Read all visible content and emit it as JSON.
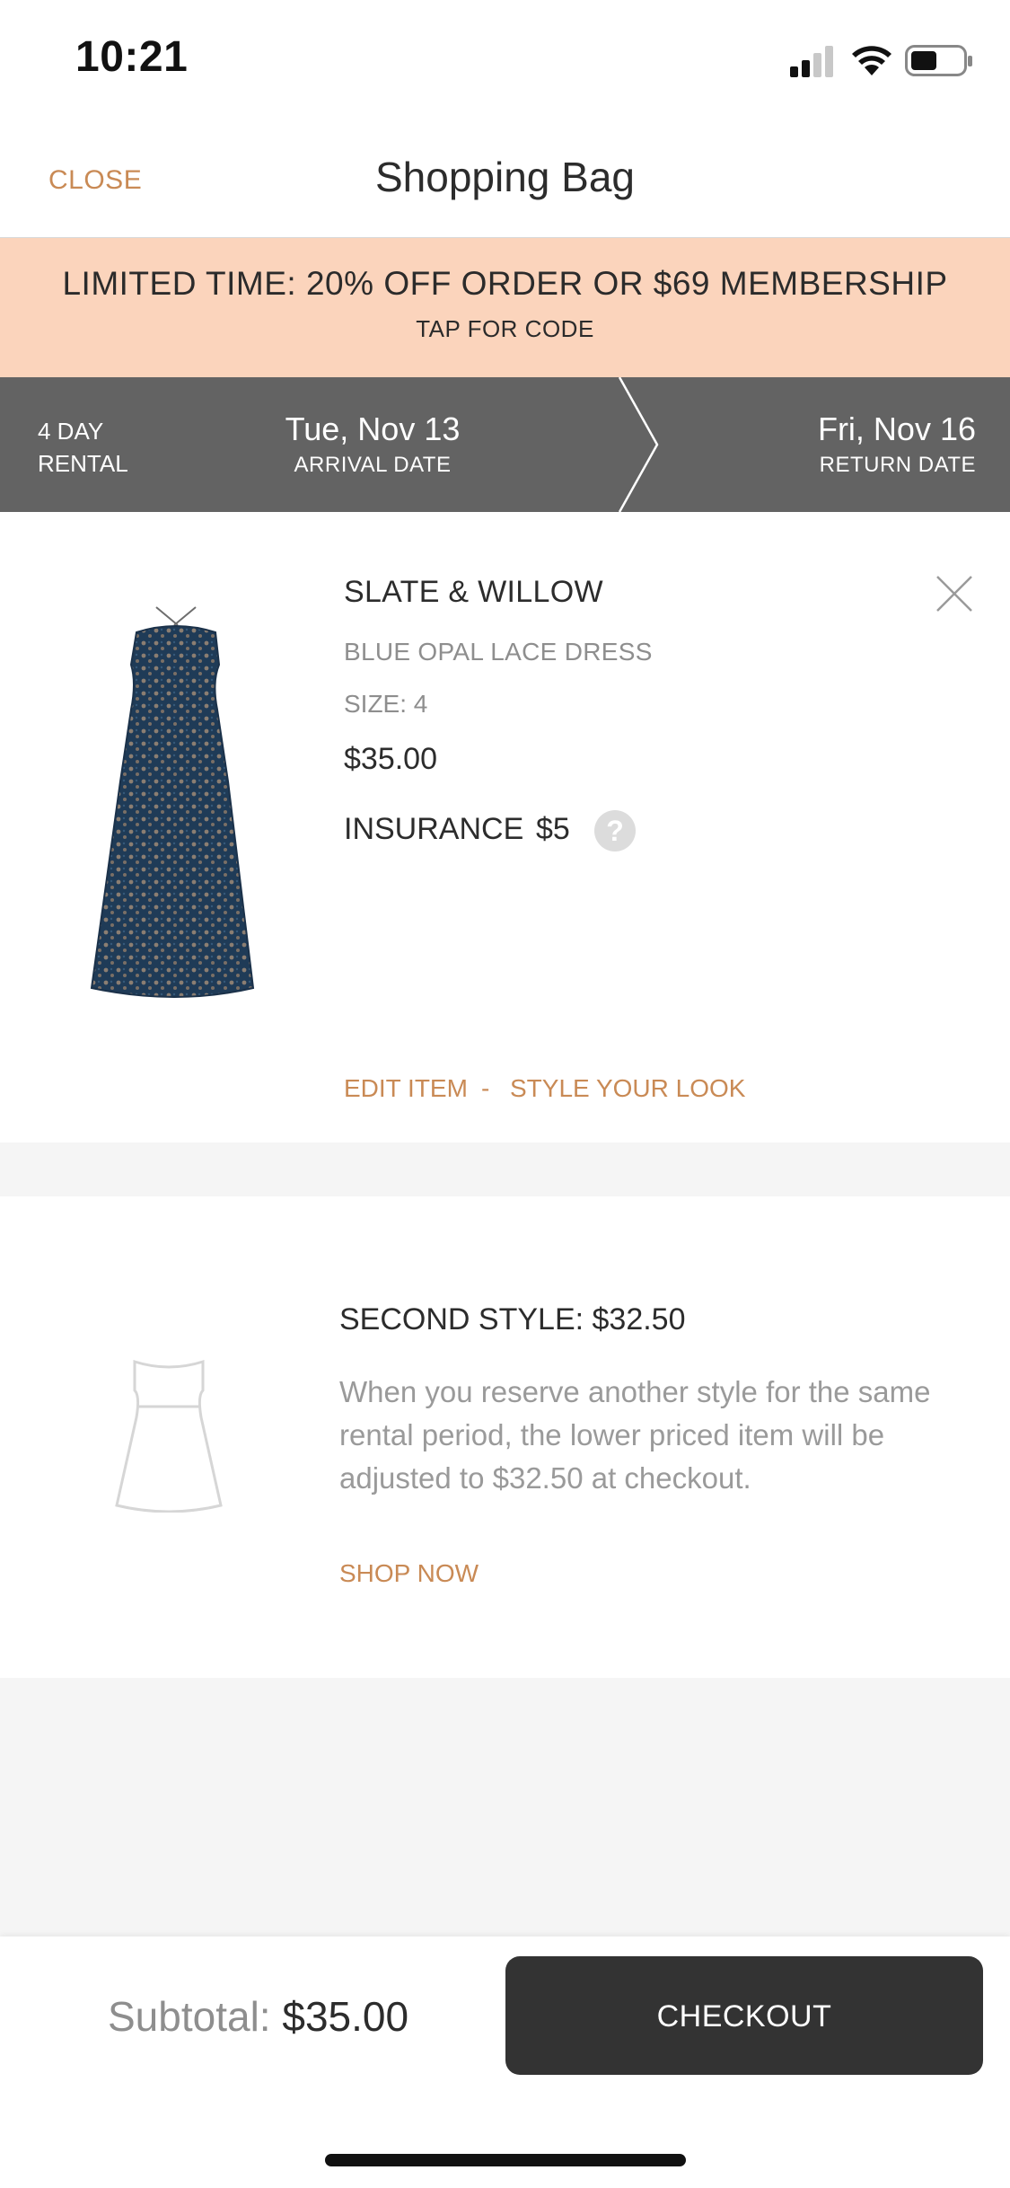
{
  "status_bar": {
    "time": "10:21"
  },
  "nav": {
    "close_label": "CLOSE",
    "title": "Shopping Bag"
  },
  "promo": {
    "title": "LIMITED TIME: 20% OFF ORDER OR $69 MEMBERSHIP",
    "subtitle": "TAP FOR CODE"
  },
  "rental": {
    "days_line1": "4 DAY",
    "days_line2": "RENTAL",
    "arrival_date": "Tue, Nov 13",
    "arrival_label": "ARRIVAL DATE",
    "return_date": "Fri, Nov 16",
    "return_label": "RETURN DATE"
  },
  "item": {
    "brand": "SLATE & WILLOW",
    "name": "BLUE OPAL LACE DRESS",
    "size": "SIZE: 4",
    "price": "$35.00",
    "insurance_label": "INSURANCE",
    "insurance_price": "$5",
    "help": "?",
    "edit_label": "EDIT ITEM",
    "separator": "-",
    "style_label": "STYLE YOUR LOOK"
  },
  "second_style": {
    "title": "SECOND STYLE: $32.50",
    "description": "When you reserve another style for the same rental period, the lower priced item will be adjusted to $32.50 at checkout.",
    "cta": "SHOP NOW"
  },
  "footer": {
    "subtotal_label": "Subtotal:",
    "subtotal_value": "$35.00",
    "checkout_label": "CHECKOUT"
  },
  "colors": {
    "accent": "#c98a55",
    "promo_bg": "#fbd4bc",
    "rental_bg": "#636363",
    "checkout_bg": "#333333"
  },
  "icons": [
    "signal-icon",
    "wifi-icon",
    "battery-icon",
    "close-x-icon",
    "help-icon",
    "dress-outline-icon"
  ]
}
